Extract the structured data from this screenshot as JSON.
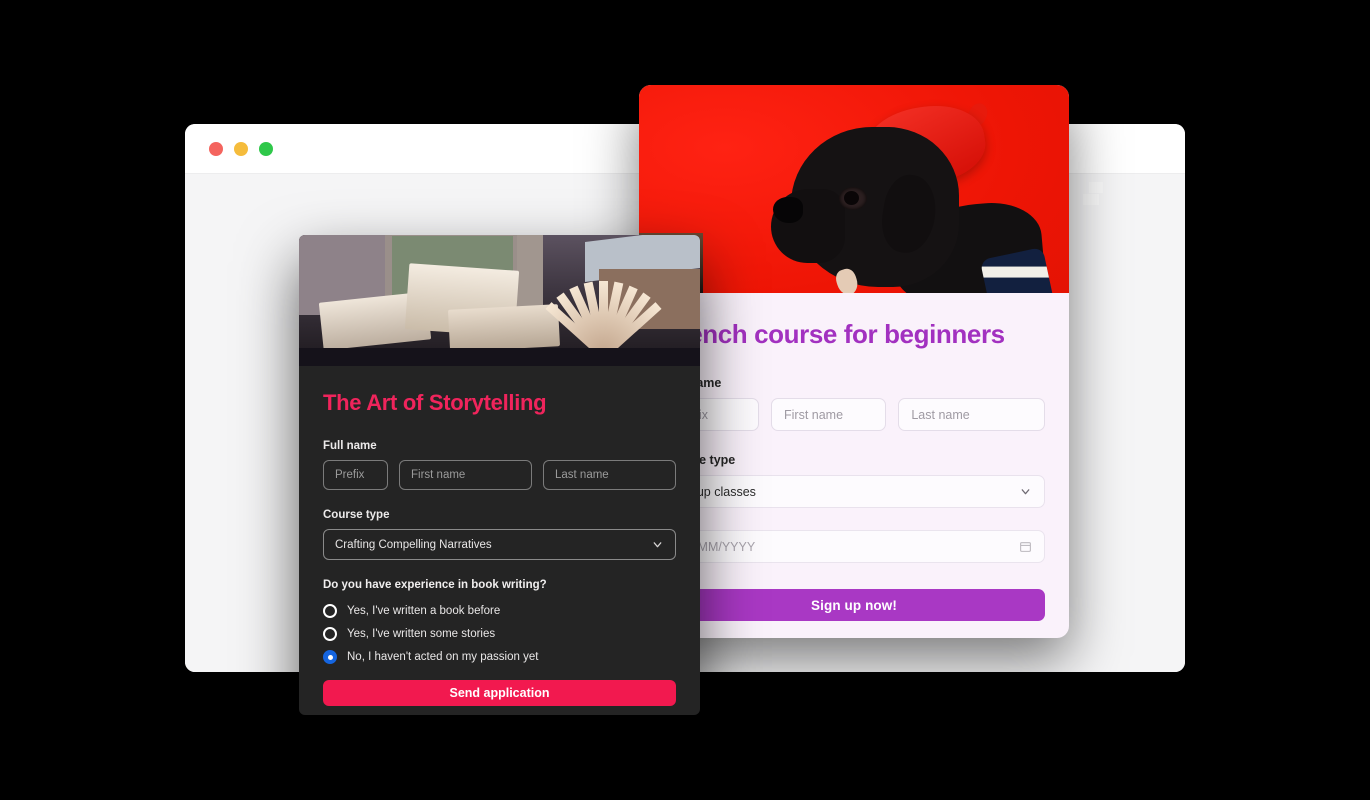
{
  "browser": {
    "traffic_lights": [
      {
        "name": "close",
        "color": "#f4645e"
      },
      {
        "name": "minimize",
        "color": "#f5bc3c"
      },
      {
        "name": "maximize",
        "color": "#2fc84a"
      }
    ]
  },
  "purple_card": {
    "hero_image_alt": "black-pug-wearing-red-beret-on-red-background",
    "title": "French course for beginners",
    "name_label": "Full name",
    "prefix_placeholder": "Prefix",
    "first_name_placeholder": "First name",
    "last_name_placeholder": "Last name",
    "course_type_label": "Course type",
    "course_type_value": "Group classes",
    "date_placeholder": "DD/MM/YYYY",
    "submit_label": "Sign up now!",
    "accent_color": "#a231c0",
    "hero_color": "#ee1505",
    "background_color": "#faf2fb"
  },
  "dark_card": {
    "hero_image_alt": "open-books-on-a-windowsill",
    "title": "The Art of Storytelling",
    "name_label": "Full name",
    "prefix_placeholder": "Prefix",
    "first_name_placeholder": "First name",
    "last_name_placeholder": "Last name",
    "course_type_label": "Course type",
    "course_type_value": "Crafting Compelling Narratives",
    "question_label": "Do you have experience in book writing?",
    "options": [
      {
        "label": "Yes, I've written a book before",
        "selected": false
      },
      {
        "label": "Yes, I've written some stories",
        "selected": false
      },
      {
        "label": "No, I haven't acted on my passion yet",
        "selected": true
      }
    ],
    "submit_label": "Send application",
    "accent_color": "#f0245c",
    "radio_selected_color": "#1565e0",
    "background_color": "#242424"
  }
}
